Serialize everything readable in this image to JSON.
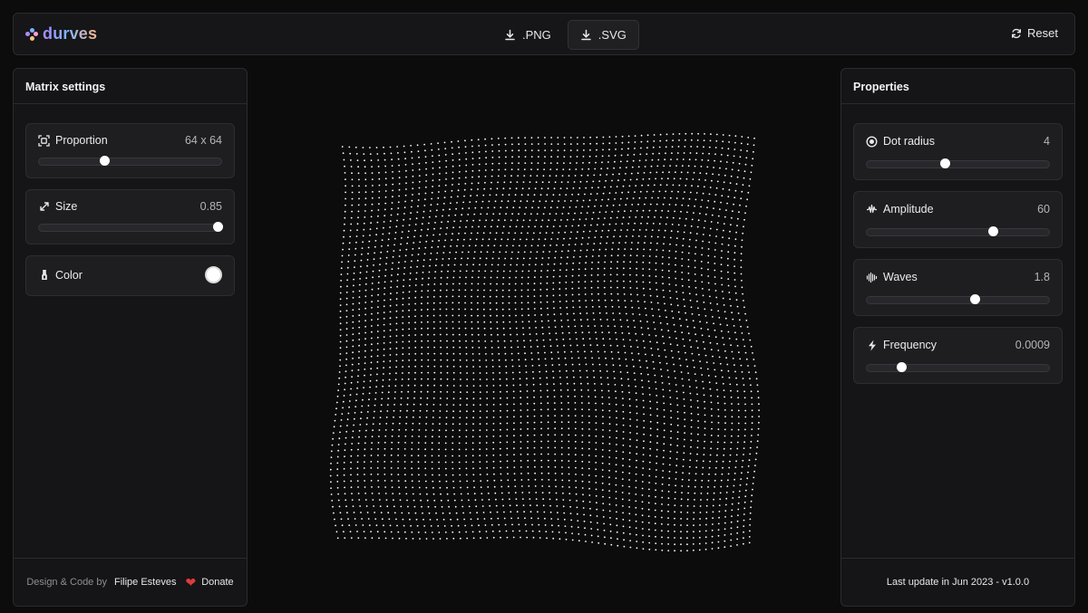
{
  "app": {
    "name": "durves",
    "logo_dot_colors": [
      "#a98cff",
      "#7fb4ff",
      "#ff9fd2",
      "#ffc48a"
    ]
  },
  "header": {
    "export_png_label": ".PNG",
    "export_svg_label": ".SVG",
    "reset_label": "Reset"
  },
  "matrix_settings": {
    "title": "Matrix settings",
    "proportion": {
      "label": "Proportion",
      "value": "64 x 64",
      "fraction": 0.36
    },
    "size": {
      "label": "Size",
      "value": "0.85",
      "fraction": 0.98
    },
    "color": {
      "label": "Color",
      "value_hex": "#ffffff"
    }
  },
  "properties": {
    "title": "Properties",
    "dot_radius": {
      "label": "Dot radius",
      "value": "4",
      "fraction": 0.43
    },
    "amplitude": {
      "label": "Amplitude",
      "value": "60",
      "fraction": 0.69
    },
    "waves": {
      "label": "Waves",
      "value": "1.8",
      "fraction": 0.59
    },
    "frequency": {
      "label": "Frequency",
      "value": "0.0009",
      "fraction": 0.19
    }
  },
  "footer_left": {
    "credit_prefix": "Design & Code by",
    "author": "Filipe Esteves",
    "donate_label": "Donate"
  },
  "footer_right": {
    "last_update": "Last update in Jun 2023 - v1.0.0"
  },
  "canvas": {
    "dot_color": "#ffffff",
    "background": "#0c0c0d"
  }
}
